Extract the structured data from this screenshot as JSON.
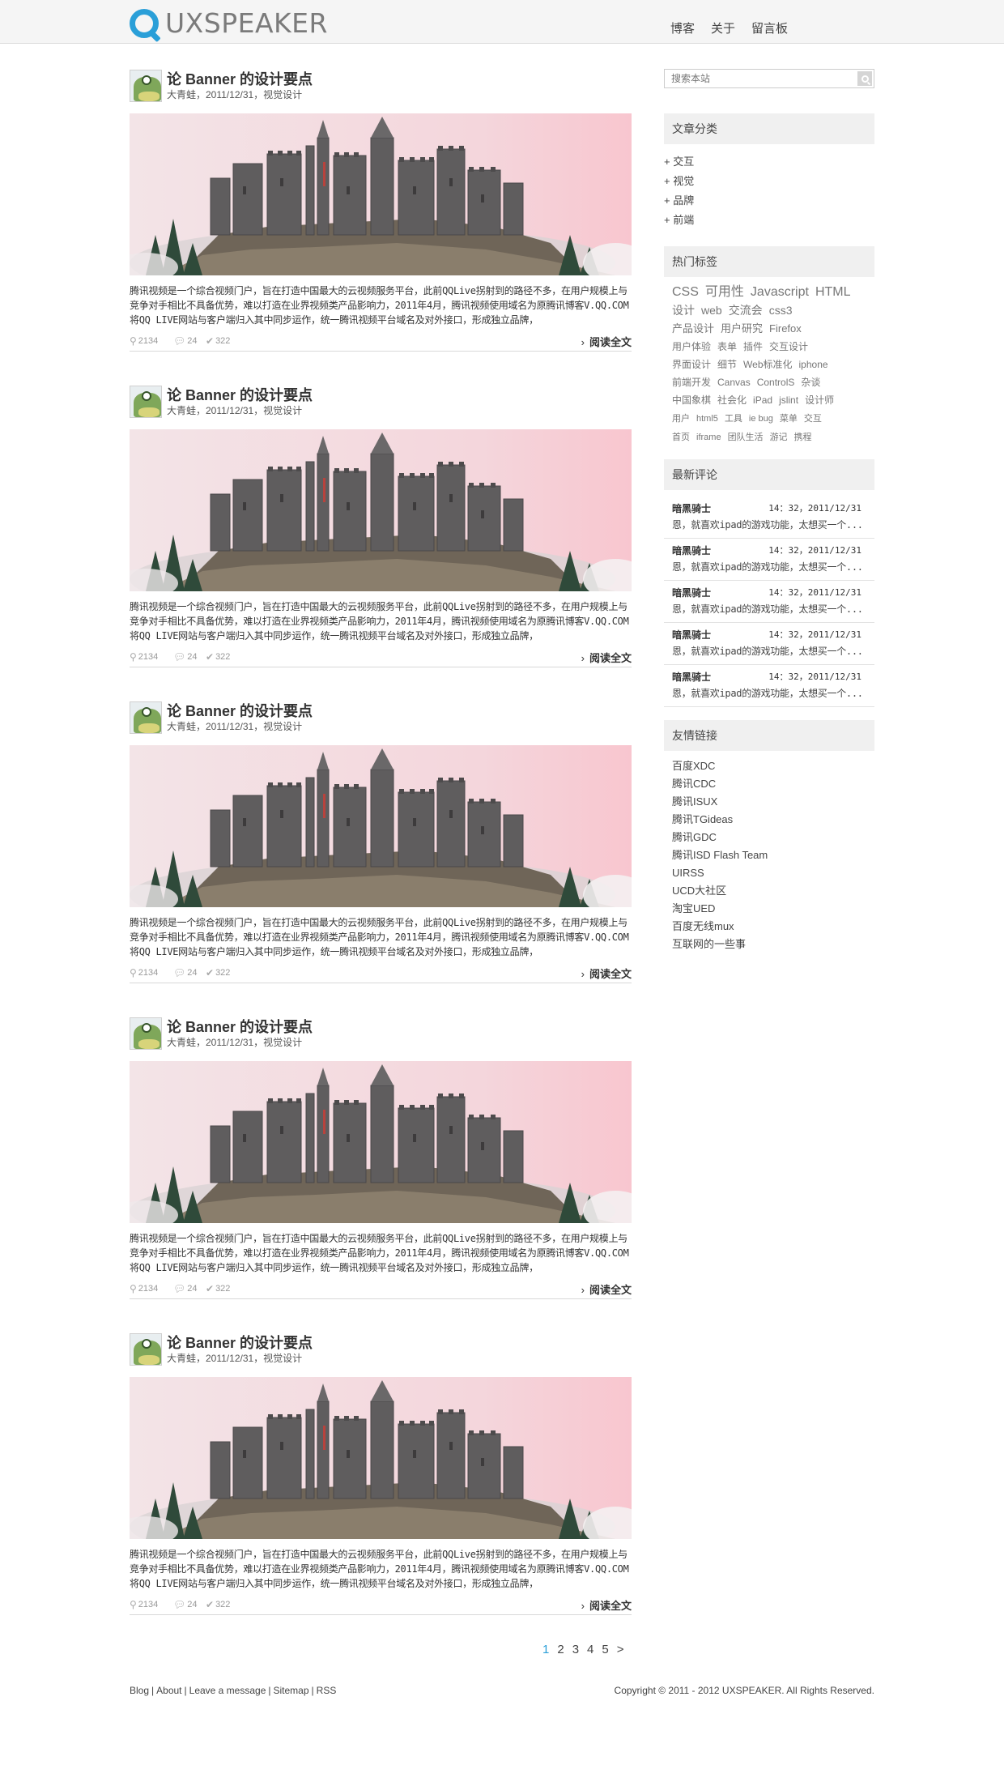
{
  "header": {
    "logo_text": "UXSPEAKER",
    "nav": [
      "博客",
      "关于",
      "留言板"
    ]
  },
  "colors": {
    "accent": "#2a9fd8",
    "topbar": "#f5f5f5",
    "widget_bg": "#f0f0f0"
  },
  "posts": [
    {
      "title": "论 Banner 的设计要点",
      "meta": "大青蛙，2011/12/31，视觉设计",
      "excerpt": "腾讯视频是一个综合视频门户，旨在打造中国最大的云视频服务平台，此前QQLive拐射到的路径不多，在用户规模上与竞争对手相比不具备优势，难以打造在业界视频类产品影响力，2011年4月，腾讯视频使用域名为原腾讯博客V.QQ.COM将QQ LIVE网站与客户端归入其中同步运作，统一腾讯视频平台域名及对外接口，形成独立品牌，",
      "views": "2134",
      "comments": "24",
      "likes": "322",
      "read_more": "阅读全文"
    },
    {
      "title": "论 Banner 的设计要点",
      "meta": "大青蛙，2011/12/31，视觉设计",
      "excerpt": "腾讯视频是一个综合视频门户，旨在打造中国最大的云视频服务平台，此前QQLive拐射到的路径不多，在用户规模上与竞争对手相比不具备优势，难以打造在业界视频类产品影响力，2011年4月，腾讯视频使用域名为原腾讯博客V.QQ.COM将QQ LIVE网站与客户端归入其中同步运作，统一腾讯视频平台域名及对外接口，形成独立品牌，",
      "views": "2134",
      "comments": "24",
      "likes": "322",
      "read_more": "阅读全文"
    },
    {
      "title": "论 Banner 的设计要点",
      "meta": "大青蛙，2011/12/31，视觉设计",
      "excerpt": "腾讯视频是一个综合视频门户，旨在打造中国最大的云视频服务平台，此前QQLive拐射到的路径不多，在用户规模上与竞争对手相比不具备优势，难以打造在业界视频类产品影响力，2011年4月，腾讯视频使用域名为原腾讯博客V.QQ.COM将QQ LIVE网站与客户端归入其中同步运作，统一腾讯视频平台域名及对外接口，形成独立品牌，",
      "views": "2134",
      "comments": "24",
      "likes": "322",
      "read_more": "阅读全文"
    },
    {
      "title": "论 Banner 的设计要点",
      "meta": "大青蛙，2011/12/31，视觉设计",
      "excerpt": "腾讯视频是一个综合视频门户，旨在打造中国最大的云视频服务平台，此前QQLive拐射到的路径不多，在用户规模上与竞争对手相比不具备优势，难以打造在业界视频类产品影响力，2011年4月，腾讯视频使用域名为原腾讯博客V.QQ.COM将QQ LIVE网站与客户端归入其中同步运作，统一腾讯视频平台域名及对外接口，形成独立品牌，",
      "views": "2134",
      "comments": "24",
      "likes": "322",
      "read_more": "阅读全文"
    },
    {
      "title": "论 Banner 的设计要点",
      "meta": "大青蛙，2011/12/31，视觉设计",
      "excerpt": "腾讯视频是一个综合视频门户，旨在打造中国最大的云视频服务平台，此前QQLive拐射到的路径不多，在用户规模上与竞争对手相比不具备优势，难以打造在业界视频类产品影响力，2011年4月，腾讯视频使用域名为原腾讯博客V.QQ.COM将QQ LIVE网站与客户端归入其中同步运作，统一腾讯视频平台域名及对外接口，形成独立品牌，",
      "views": "2134",
      "comments": "24",
      "likes": "322",
      "read_more": "阅读全文"
    }
  ],
  "pagination": [
    "1",
    "2",
    "3",
    "4",
    "5",
    ">"
  ],
  "footer": {
    "links": [
      "Blog",
      "About",
      "Leave a message",
      "Sitemap",
      "RSS"
    ],
    "copyright": "Copyright © 2011 - 2012 UXSPEAKER. All Rights Reserved."
  },
  "sidebar": {
    "search_placeholder": "搜索本站",
    "categories_title": "文章分类",
    "categories": [
      "+ 交互",
      "+ 视觉",
      "+ 品牌",
      "+ 前端"
    ],
    "tags_title": "热门标签",
    "tags": [
      [
        "CSS",
        "可用性",
        "Javascript",
        "HTML"
      ],
      [
        "设计",
        "web",
        "交流会",
        "css3"
      ],
      [
        "产品设计",
        "用户研究",
        "Firefox"
      ],
      [
        "用户体验",
        "表单",
        "插件",
        "交互设计"
      ],
      [
        "界面设计",
        "细节",
        "Web标准化",
        "iphone"
      ],
      [
        "前端开发",
        "Canvas",
        "ControlS",
        "杂谈"
      ],
      [
        "中国象棋",
        "社会化",
        "iPad",
        "jslint",
        "设计师"
      ],
      [
        "用户",
        "html5",
        "工具",
        "ie bug",
        "菜单",
        "交互"
      ],
      [
        "首页",
        "iframe",
        "团队生活",
        "游记",
        "携程"
      ]
    ],
    "comments_title": "最新评论",
    "comments": [
      {
        "author": "暗黑骑士",
        "time": "14：32，2011/12/31",
        "text": "恩，就喜欢ipad的游戏功能，太想买一个..."
      },
      {
        "author": "暗黑骑士",
        "time": "14：32，2011/12/31",
        "text": "恩，就喜欢ipad的游戏功能，太想买一个..."
      },
      {
        "author": "暗黑骑士",
        "time": "14：32，2011/12/31",
        "text": "恩，就喜欢ipad的游戏功能，太想买一个..."
      },
      {
        "author": "暗黑骑士",
        "time": "14：32，2011/12/31",
        "text": "恩，就喜欢ipad的游戏功能，太想买一个..."
      },
      {
        "author": "暗黑骑士",
        "time": "14：32，2011/12/31",
        "text": "恩，就喜欢ipad的游戏功能，太想买一个..."
      }
    ],
    "links_title": "友情链接",
    "links": [
      "百度XDC",
      "腾讯CDC",
      "腾讯ISUX",
      "腾讯TGideas",
      "腾讯GDC",
      "腾讯ISD Flash Team",
      "UIRSS",
      "UCD大社区",
      "淘宝UED",
      "百度无线mux",
      "互联网的一些事"
    ]
  }
}
